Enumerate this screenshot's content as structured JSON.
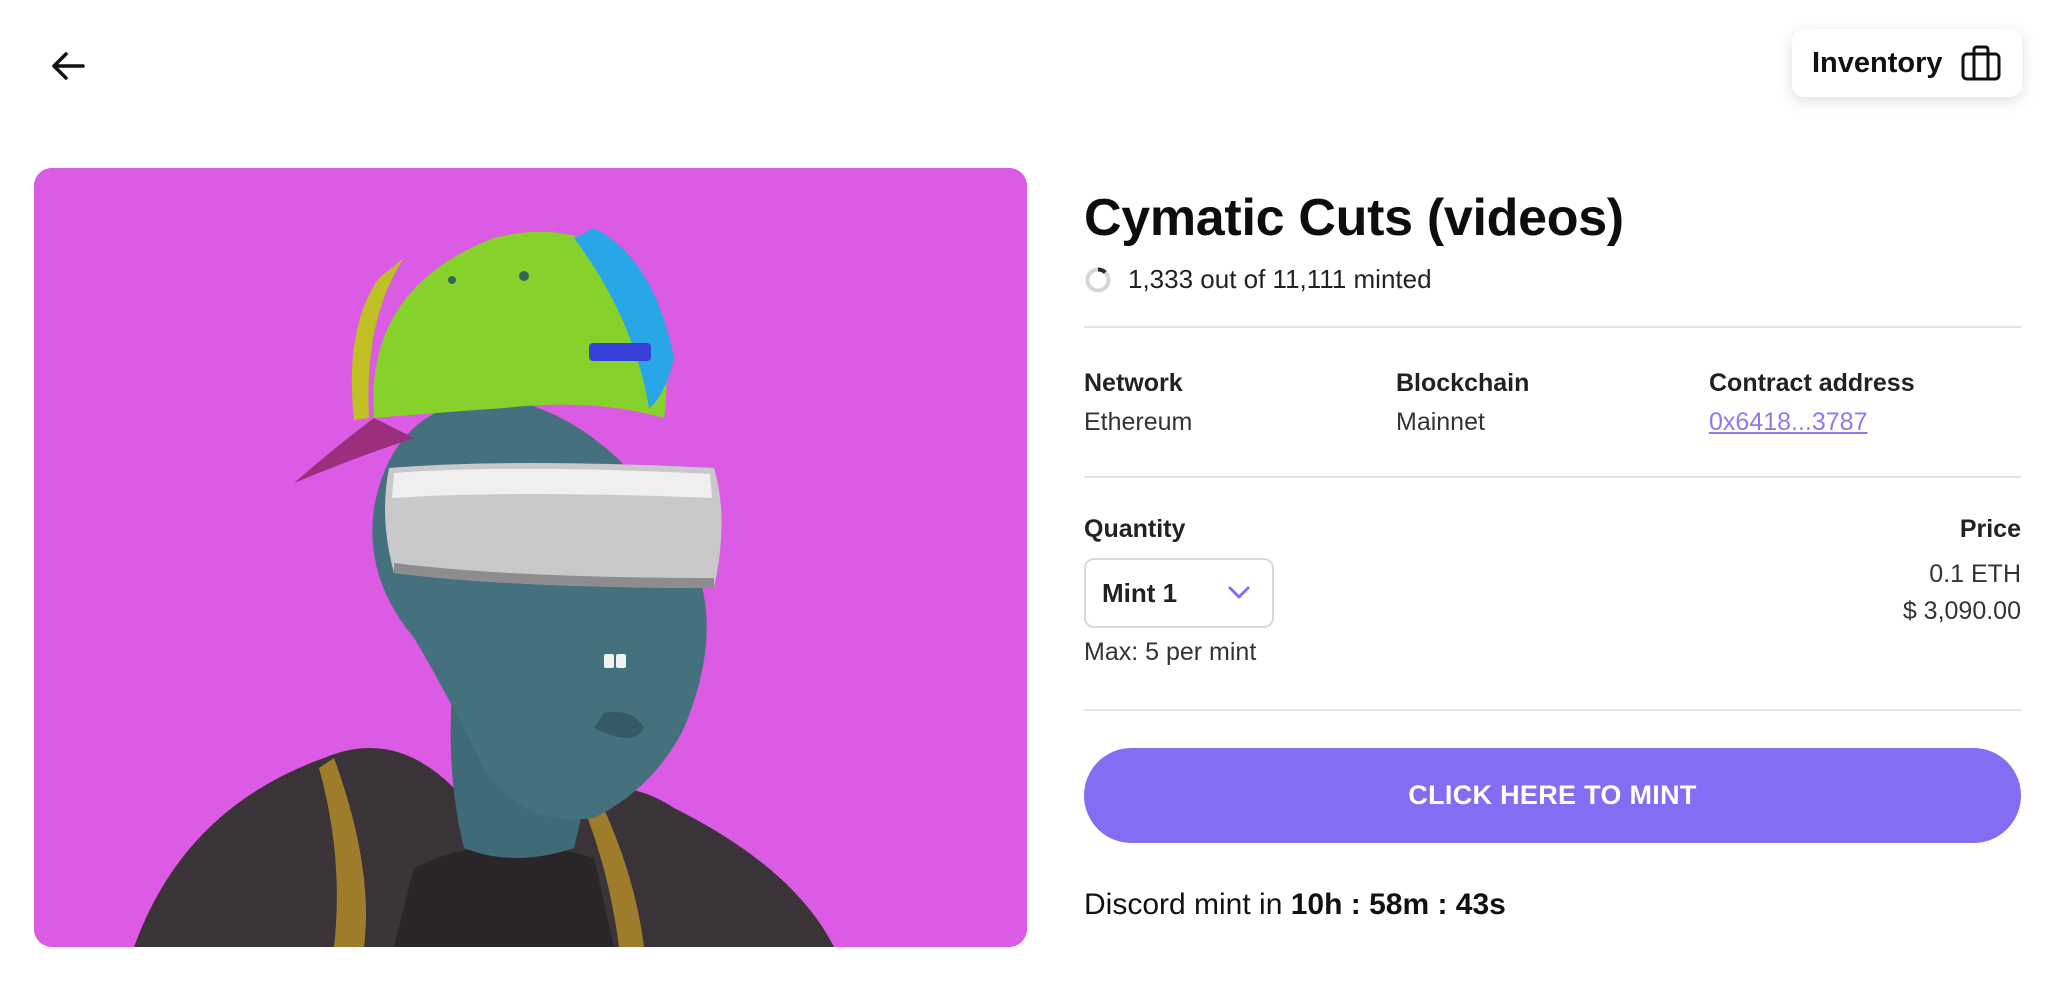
{
  "header": {
    "back_icon": "arrow-left-icon",
    "inventory_label": "Inventory",
    "inventory_icon": "briefcase-icon"
  },
  "hero": {
    "background_color": "#dc5be4"
  },
  "collection": {
    "title": "Cymatic Cuts (videos)",
    "minted_text": "1,333 out of 11,111 minted",
    "minted_progress": 0.12
  },
  "details": {
    "network_label": "Network",
    "network_value": "Ethereum",
    "blockchain_label": "Blockchain",
    "blockchain_value": "Mainnet",
    "contract_label": "Contract address",
    "contract_value": "0x6418...3787"
  },
  "mint": {
    "quantity_label": "Quantity",
    "quantity_selected": "Mint 1",
    "max_note": "Max: 5 per mint",
    "price_label": "Price",
    "price_eth": "0.1 ETH",
    "price_usd": "$ 3,090.00",
    "button_label": "CLICK HERE TO MINT",
    "countdown_prefix": "Discord mint in",
    "countdown_value": "10h : 58m : 43s"
  },
  "colors": {
    "accent": "#826ef2",
    "link": "#8b7cf0"
  }
}
